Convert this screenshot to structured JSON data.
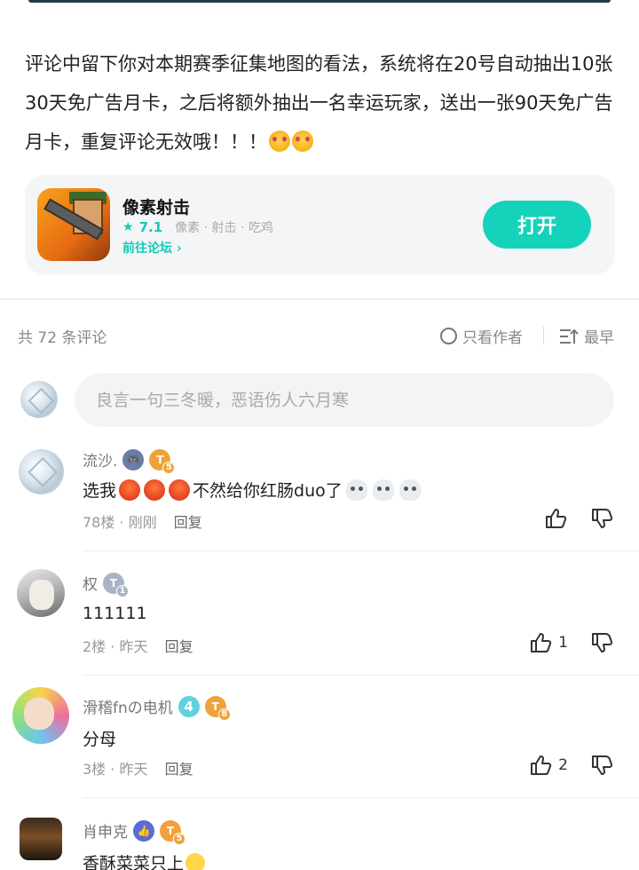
{
  "post": {
    "body": "评论中留下你对本期赛季征集地图的看法，系统将在20号自动抽出10张30天免广告月卡，之后将额外抽出一名幸运玩家，送出一张90天免广告月卡，重复评论无效哦！！！",
    "emojis": [
      "heart-eyes-emoji",
      "heart-eyes-emoji"
    ]
  },
  "app_card": {
    "name": "像素射击",
    "rating": "7.1",
    "tags": "像素 · 射击 · 吃鸡",
    "forum_link": "前往论坛",
    "open_button": "打开"
  },
  "comments_header": {
    "count_label": "共 72 条评论",
    "author_only_label": "只看作者",
    "sort_label": "最早"
  },
  "comment_input": {
    "placeholder": "良言一句三冬暖，恶语伤人六月寒"
  },
  "comments": [
    {
      "username": "流沙.",
      "badges": [
        "gamepad-badge",
        "level-badge"
      ],
      "badge_level": "5",
      "text_before": "选我",
      "text_after": "不然给你红肠duo了",
      "floor": "78楼",
      "time": "刚刚",
      "reply_label": "回复",
      "like_count": "",
      "avatar": "ice"
    },
    {
      "username": "权",
      "badges": [
        "level-badge"
      ],
      "badge_level": "1",
      "text": "111111",
      "floor": "2楼",
      "time": "昨天",
      "reply_label": "回复",
      "like_count": "1",
      "avatar": "anime"
    },
    {
      "username": "滑稽fnの电机",
      "level_number": "4",
      "badge_level": "8",
      "text": "分母",
      "floor": "3楼",
      "time": "昨天",
      "reply_label": "回复",
      "like_count": "2",
      "avatar": "colorful"
    },
    {
      "username": "肖申克",
      "badge_level": "5",
      "text": "香酥菜菜只上",
      "avatar": "dark"
    }
  ],
  "colors": {
    "accent": "#15d2bb",
    "text_primary": "#1f1f1f",
    "text_secondary": "#999999",
    "card_bg": "#f4f5f7"
  }
}
